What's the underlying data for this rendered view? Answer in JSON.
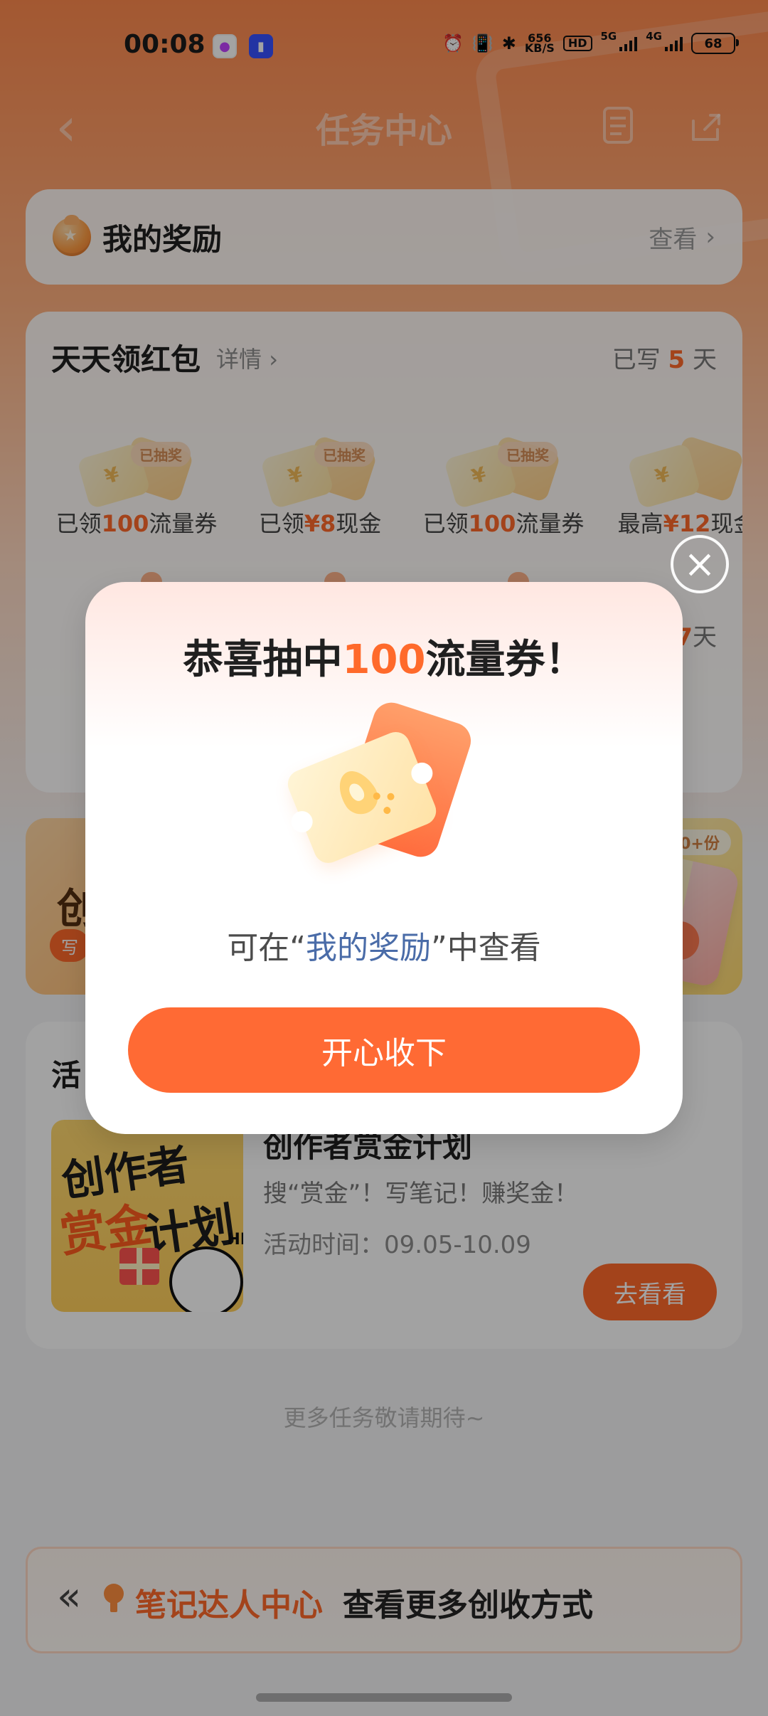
{
  "status": {
    "time": "00:08",
    "network_speed_top": "656",
    "network_speed_bottom": "KB/S",
    "hd": "HD",
    "signal_5g": "5G",
    "signal_4g": "4G",
    "battery": "68"
  },
  "header": {
    "title": "任务中心"
  },
  "reward_card": {
    "title": "我的奖励",
    "action": "查看"
  },
  "packet_section": {
    "title": "天天领红包",
    "detail": "详情",
    "streak_prefix": "已写",
    "streak_days": "5",
    "streak_suffix": "天",
    "items": [
      {
        "badge": "已抽奖",
        "prefix": "已领",
        "highlight": "100",
        "suffix": "流量券"
      },
      {
        "badge": "已抽奖",
        "prefix": "已领",
        "highlight": "¥8",
        "suffix": "现金"
      },
      {
        "badge": "已抽奖",
        "prefix": "已领",
        "highlight": "100",
        "suffix": "流量券"
      },
      {
        "badge": "",
        "prefix": "最高",
        "highlight": "¥12",
        "suffix": "现金"
      }
    ],
    "partial_days_num": "7",
    "partial_days_suffix": "天"
  },
  "promo": {
    "left_big": "创",
    "left_pill": "写",
    "right_tag": "0+份"
  },
  "activity": {
    "section_title": "活",
    "item_title": "创作者赏金计划",
    "desc": "搜“赏金”！写笔记！赚奖金！",
    "time": "活动时间：09.05-10.09",
    "button": "去看看",
    "thumb_line_1": "创作者",
    "thumb_line_2": "赏金",
    "thumb_line_3": "计划"
  },
  "more_tasks": "更多任务敬请期待~",
  "footer": {
    "label": "笔记达人中心",
    "text": "查看更多创收方式"
  },
  "modal": {
    "title_prefix": "恭喜抽中",
    "title_highlight": "100",
    "title_suffix": "流量券！",
    "subtitle_prefix": "可在“",
    "subtitle_link": "我的奖励",
    "subtitle_suffix": "”中查看",
    "button": "开心收下"
  }
}
